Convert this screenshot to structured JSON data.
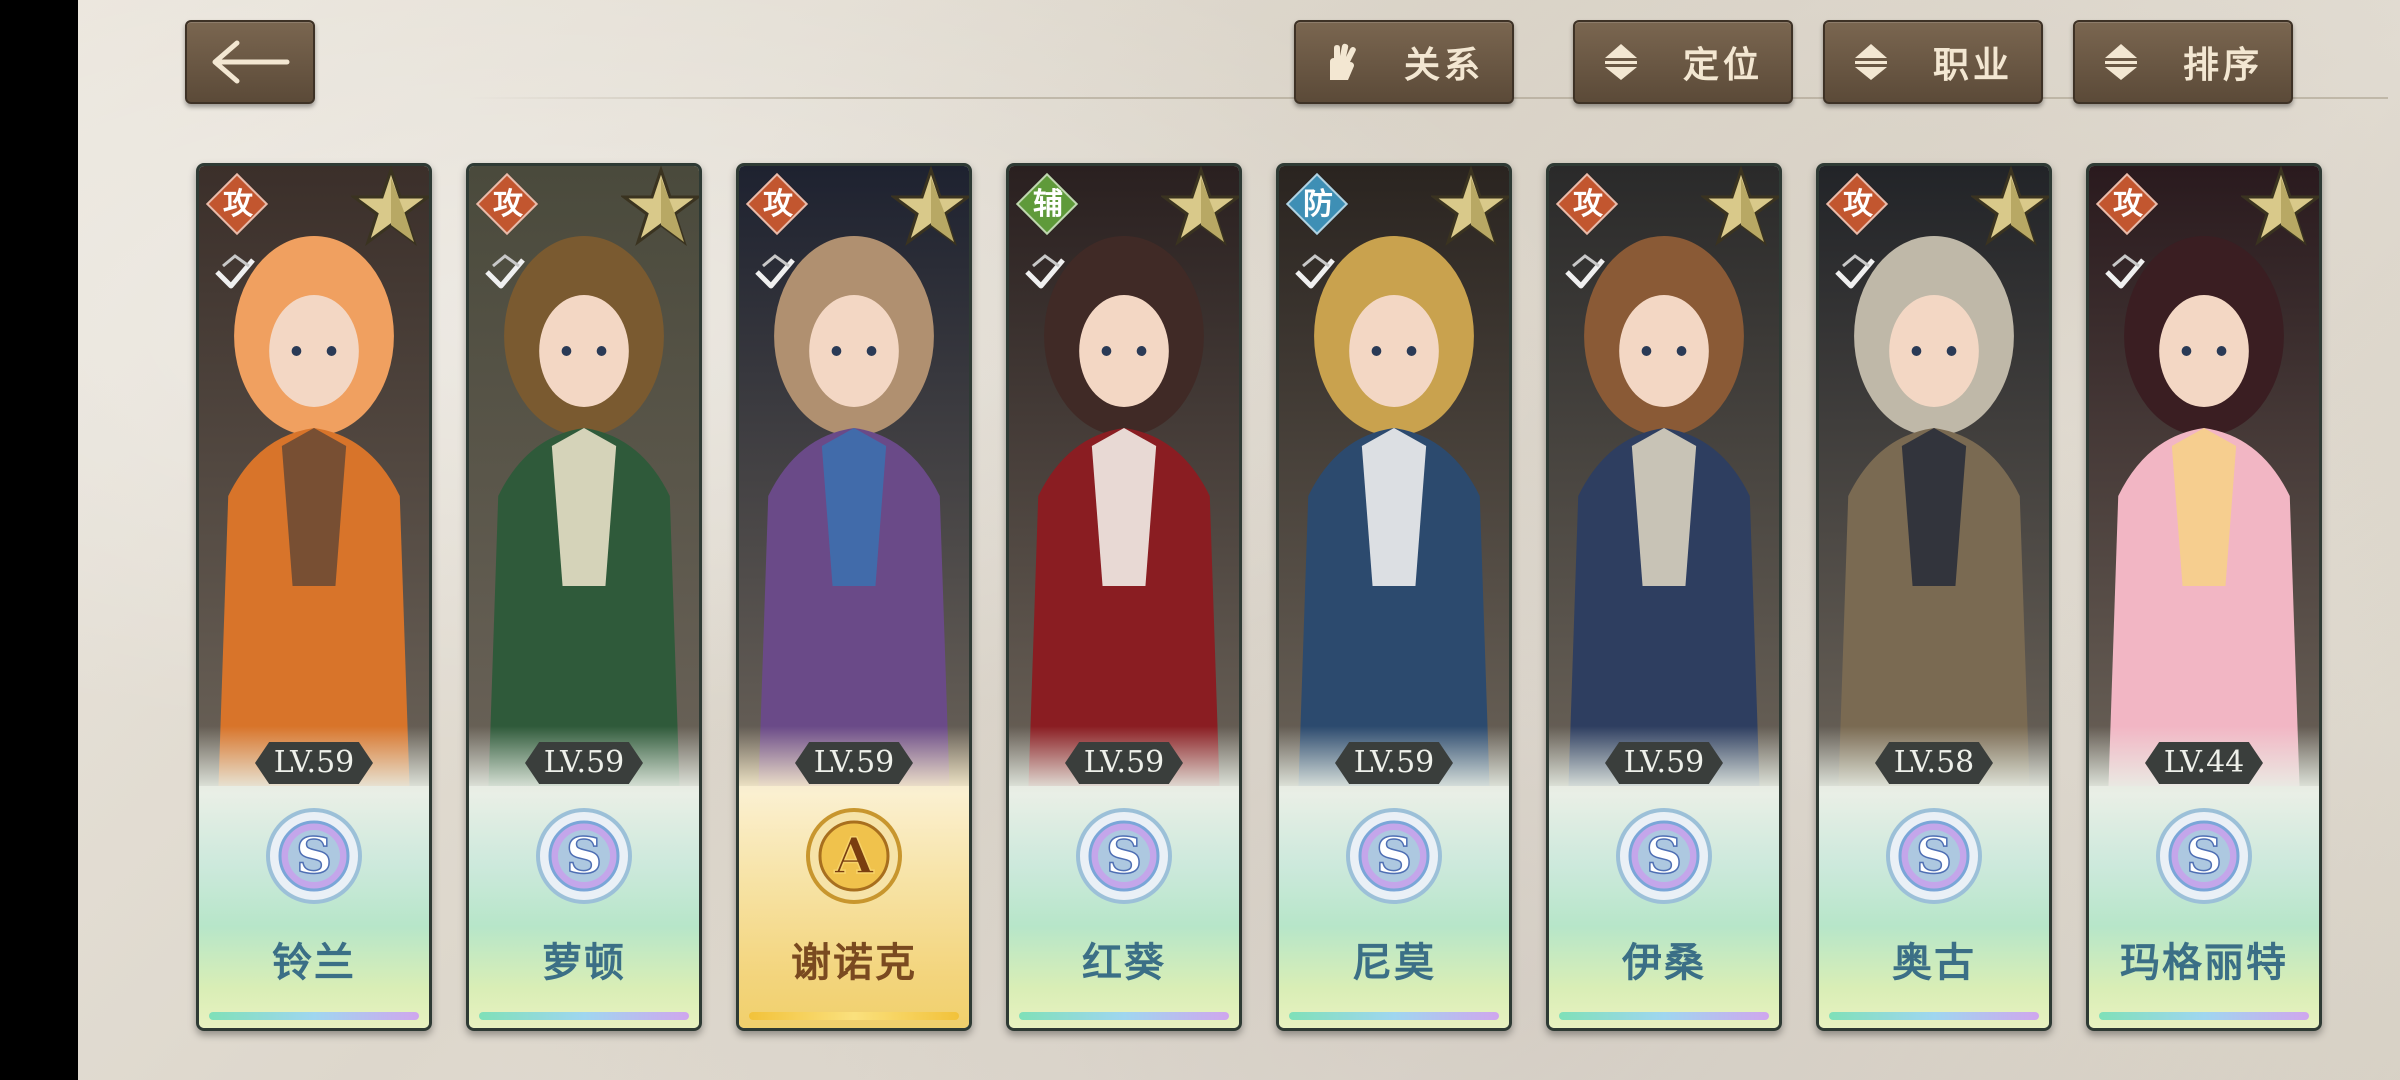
{
  "toolbar": {
    "back_icon": "arrow-left-icon",
    "filters": [
      {
        "label": "关系",
        "icon": "gloved-hand-icon"
      },
      {
        "label": "定位",
        "icon": "sort-arrows-icon"
      },
      {
        "label": "职业",
        "icon": "sort-arrows-icon"
      },
      {
        "label": "排序",
        "icon": "sort-arrows-icon"
      }
    ]
  },
  "colors": {
    "accent_button": "#6a5744",
    "attack": "#c2562f",
    "support": "#5f9a3a",
    "defense": "#3e8fb5",
    "name_text": "#3b6f86"
  },
  "characters": [
    {
      "name": "铃兰",
      "role": "攻",
      "level": "LV.59",
      "rank": "S",
      "portrait": "girl-orange-jumpsuit"
    },
    {
      "name": "萝顿",
      "role": "攻",
      "level": "LV.59",
      "rank": "S",
      "portrait": "girl-green-coat"
    },
    {
      "name": "谢诺克",
      "role": "攻",
      "level": "LV.59",
      "rank": "A",
      "portrait": "blue-hair-hat-cape"
    },
    {
      "name": "红葵",
      "role": "辅",
      "level": "LV.59",
      "rank": "S",
      "portrait": "girl-red-flower-dress"
    },
    {
      "name": "尼莫",
      "role": "防",
      "level": "LV.59",
      "rank": "S",
      "portrait": "officer-navy-uniform"
    },
    {
      "name": "伊桑",
      "role": "攻",
      "level": "LV.59",
      "rank": "S",
      "portrait": "boy-goggles-jacket"
    },
    {
      "name": "奥古",
      "role": "攻",
      "level": "LV.58",
      "rank": "S",
      "portrait": "old-officer-mech-arm"
    },
    {
      "name": "玛格丽特",
      "role": "攻",
      "level": "LV.44",
      "rank": "S",
      "portrait": "blonde-witch-pink-dress"
    }
  ]
}
